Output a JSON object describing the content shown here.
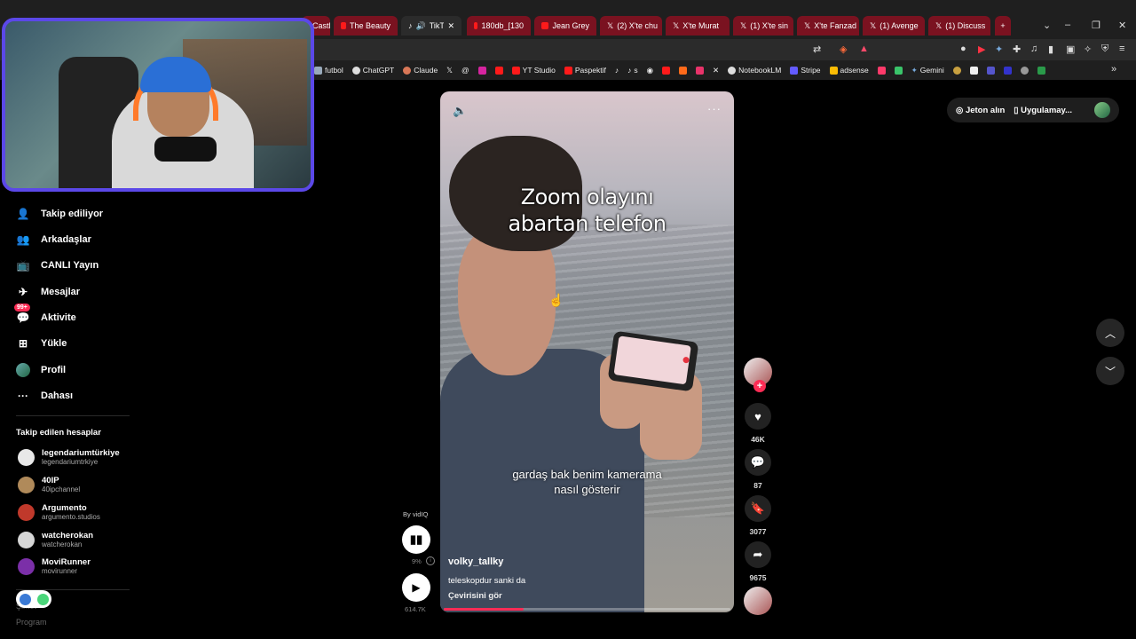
{
  "browser": {
    "tabs": [
      {
        "label": "Castle",
        "kind": "yt",
        "red": true
      },
      {
        "label": "The Beauty",
        "kind": "yt",
        "red": true
      },
      {
        "label": "TikTok",
        "kind": "tiktok",
        "red": false,
        "active": true
      },
      {
        "label": "180db_[130",
        "kind": "yt",
        "red": true
      },
      {
        "label": "Jean Grey",
        "kind": "yt",
        "red": true
      },
      {
        "label": "(2) X'te chu",
        "kind": "x",
        "red": true
      },
      {
        "label": "X'te Murat",
        "kind": "x",
        "red": true
      },
      {
        "label": "(1) X'te sin",
        "kind": "x",
        "red": true
      },
      {
        "label": "X'te Fanzad",
        "kind": "x",
        "red": true
      },
      {
        "label": "(1) Avenge",
        "kind": "x",
        "red": true
      },
      {
        "label": "(1) Discuss",
        "kind": "x",
        "red": true
      }
    ],
    "new_tab": "+",
    "bookmarks": [
      "futbol",
      "ChatGPT",
      "Claude",
      "YT Studio",
      "Paspektif",
      "s",
      "NotebookLM",
      "Stripe",
      "adsense",
      "Gemini"
    ]
  },
  "sidebar": {
    "items": [
      {
        "label": "Takip ediliyor",
        "icon": "following-icon"
      },
      {
        "label": "Arkadaşlar",
        "icon": "friends-icon"
      },
      {
        "label": "CANLI Yayın",
        "icon": "live-icon"
      },
      {
        "label": "Mesajlar",
        "icon": "messages-icon"
      },
      {
        "label": "Aktivite",
        "icon": "activity-icon",
        "badge": "99+"
      },
      {
        "label": "Yükle",
        "icon": "upload-icon"
      },
      {
        "label": "Profil",
        "icon": "profile-avatar"
      },
      {
        "label": "Dahası",
        "icon": "more-icon"
      }
    ],
    "section_title": "Takip edilen hesaplar",
    "following": [
      {
        "name": "legendariumtürkiye",
        "handle": "legendariumtrkiye",
        "color": "#e8e8e8"
      },
      {
        "name": "40IP",
        "handle": "40ipchannel",
        "color": "#b08a5a"
      },
      {
        "name": "Argumento",
        "handle": "argumento.studios",
        "color": "#c0392b"
      },
      {
        "name": "watcherokan",
        "handle": "watcherokan",
        "color": "#d6d6d6"
      },
      {
        "name": "MoviRunner",
        "handle": "movirunner",
        "color": "#7b2fa8"
      }
    ],
    "bottom_labels": [
      "Şirket",
      "Program"
    ]
  },
  "top_right": {
    "coins_label": "Jeton alın",
    "app_label": "Uygulamay..."
  },
  "video": {
    "title_line1": "Zoom olayını",
    "title_line2": "abartan telefon",
    "subtitle_line1": "gardaş bak benim kamerama",
    "subtitle_line2": "nasıl gösterir",
    "author": "volky_tallky",
    "caption": "teleskopdur sanki da",
    "translate": "Çevirisini gör",
    "progress": 0.28
  },
  "actions": {
    "likes": "46K",
    "comments": "87",
    "saves": "3077",
    "shares": "9675"
  },
  "vidiq": {
    "by": "By vidIQ",
    "percent": "9%",
    "views": "614.7K"
  },
  "colors": {
    "accent": "#fe2c55",
    "webcam_border": "#5b48e8"
  }
}
